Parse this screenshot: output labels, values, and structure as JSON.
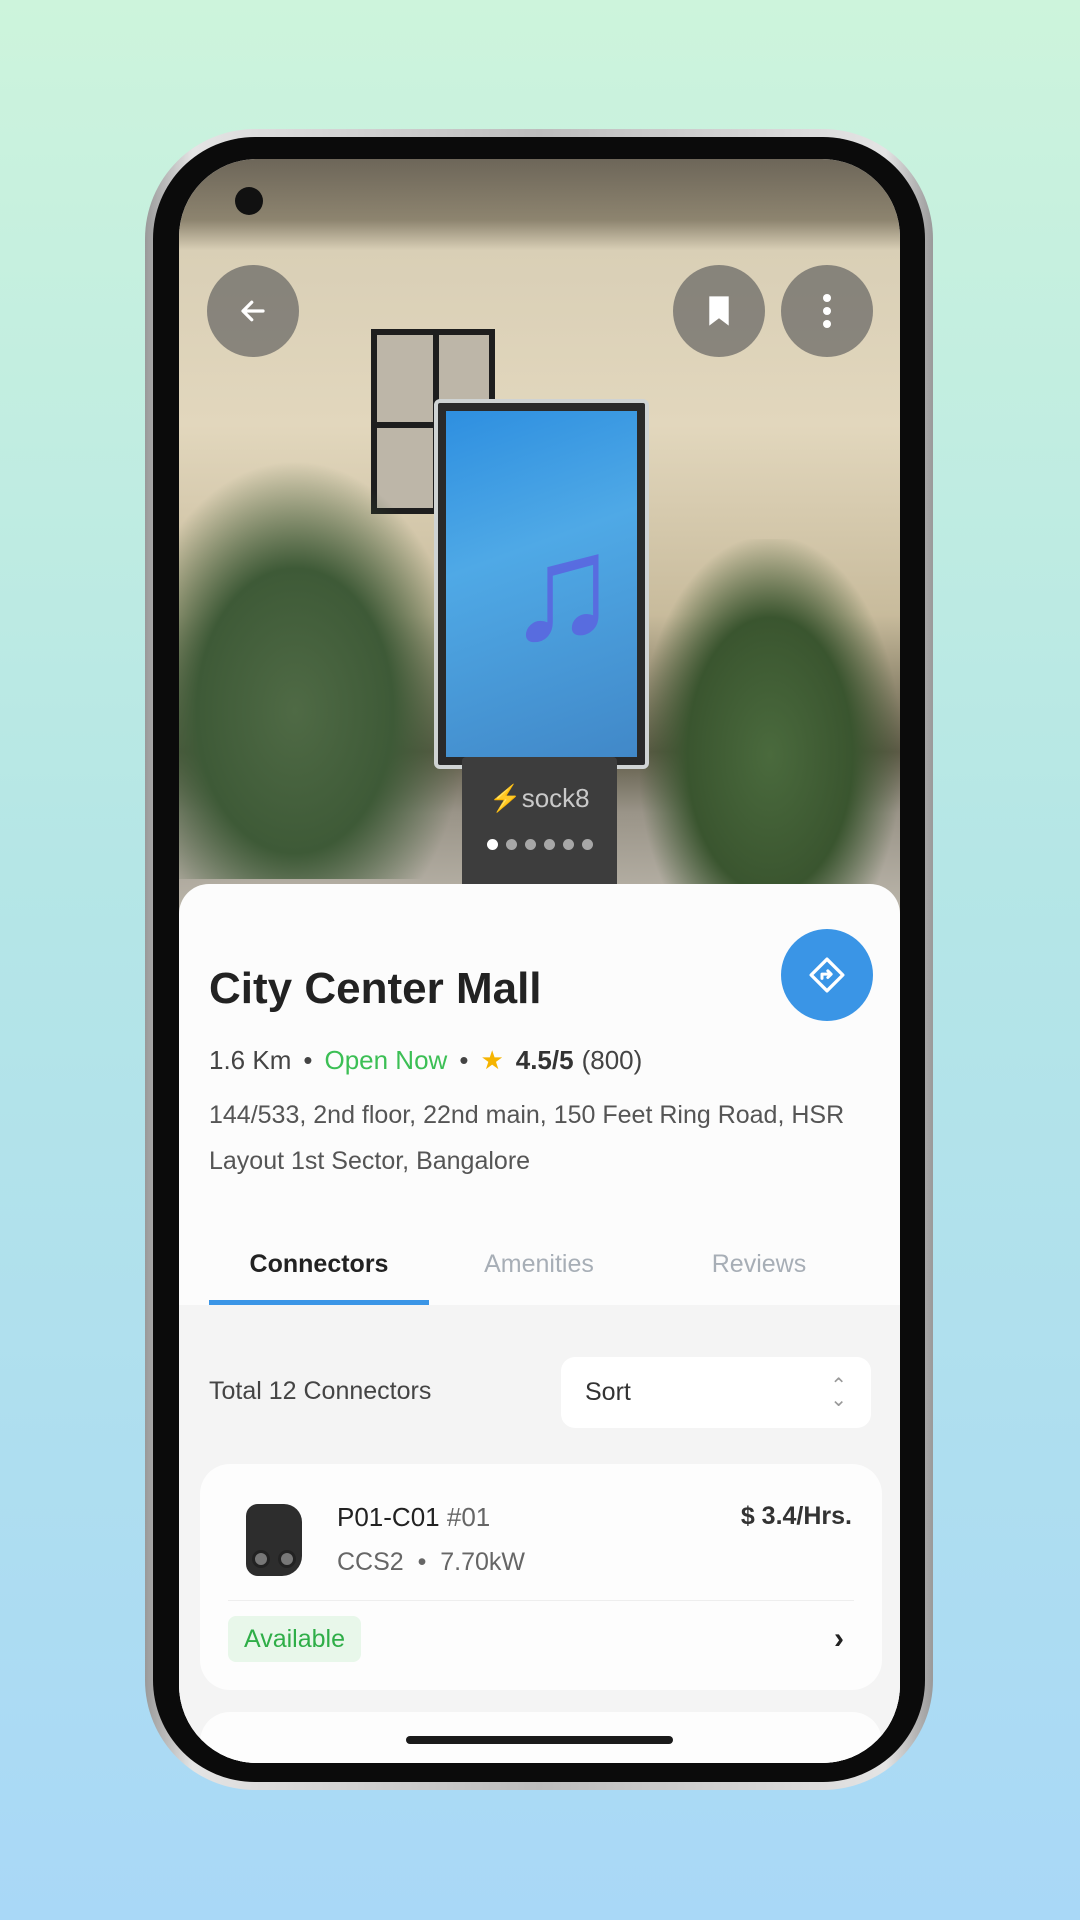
{
  "hero": {
    "brand": "sock8",
    "dots_total": 6,
    "dots_active": 0
  },
  "station": {
    "name": "City Center Mall",
    "distance": "1.6 Km",
    "status": "Open Now",
    "rating": "4.5/5",
    "reviews": "(800)",
    "address": "144/533, 2nd floor, 22nd main, 150 Feet Ring Road, HSR Layout 1st Sector, Bangalore"
  },
  "tabs": [
    {
      "label": "Connectors",
      "active": true
    },
    {
      "label": "Amenities"
    },
    {
      "label": "Reviews"
    }
  ],
  "connectors": {
    "total": "Total 12 Connectors",
    "sort_label": "Sort",
    "items": [
      {
        "name": "P01-C01",
        "number": "#01",
        "type": "CCS2",
        "power": "7.70kW",
        "price": "$ 3.4/Hrs.",
        "status": "Available"
      }
    ]
  },
  "colors": {
    "accent": "#3a95e6",
    "open": "#3cbf55",
    "available": "#2fae48",
    "star": "#f5b400"
  }
}
